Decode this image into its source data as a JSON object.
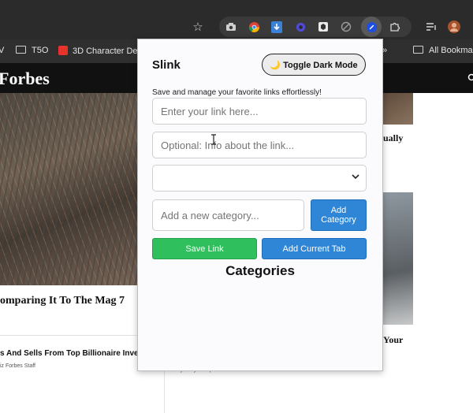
{
  "bookmarks": {
    "items": [
      "V",
      "T5O",
      "3D Character Des",
      "»",
      "All Bookmar"
    ]
  },
  "site": {
    "logo": "Forbes",
    "headline": "omparing It To The Mag 7",
    "subline": "s And Sells From Top Billionaire Investo",
    "author_left": "iz   Forbes Staff",
    "author_right": "By Kelly Phillips Erb  Forbes Staff",
    "right_text_1": "ually",
    "right_text_2": "Your"
  },
  "popup": {
    "title": "Slink",
    "toggle_label": "🌙 Toggle Dark Mode",
    "subtitle": "Save and manage your favorite links effortlessly!",
    "link_placeholder": "Enter your link here...",
    "info_placeholder": "Optional: Info about the link...",
    "category_select_value": "",
    "new_category_placeholder": "Add a new category...",
    "add_category_label": "Add Category",
    "save_link_label": "Save Link",
    "add_current_tab_label": "Add Current Tab",
    "categories_heading": "Categories"
  },
  "colors": {
    "save_green": "#2fbf5d",
    "action_blue": "#2f86d6",
    "chrome_dark": "#2b2b2b"
  },
  "icons": [
    "star-icon",
    "camera-icon",
    "chrome-icon",
    "download-icon",
    "settings-gear-icon",
    "box-icon",
    "block-icon",
    "slink-extension-icon",
    "puzzle-icon",
    "queue-icon",
    "profile-avatar-icon",
    "folder-icon",
    "cursor-icon"
  ]
}
